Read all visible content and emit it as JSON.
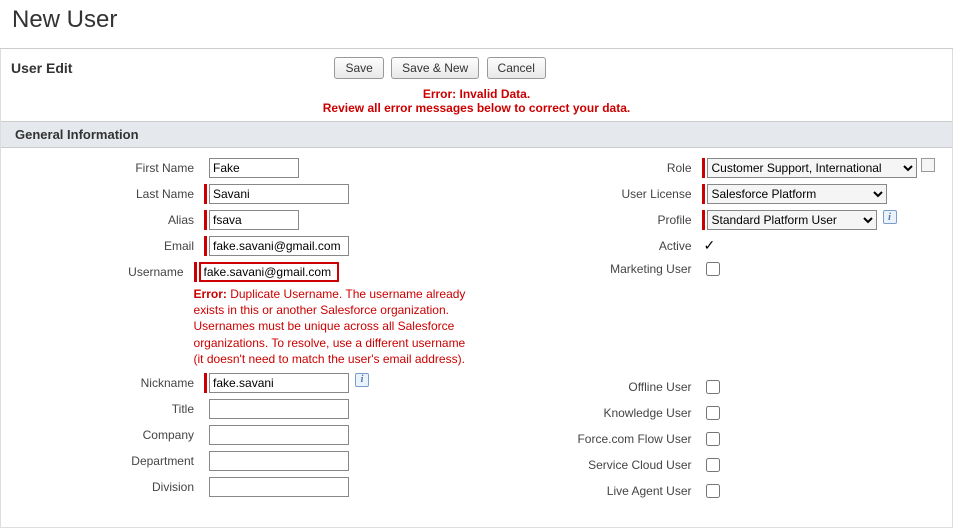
{
  "page": {
    "title": "New User",
    "panel_title": "User Edit"
  },
  "buttons": {
    "save": "Save",
    "save_new": "Save & New",
    "cancel": "Cancel"
  },
  "error_banner": {
    "line1": "Error: Invalid Data.",
    "line2": "Review all error messages below to correct your data."
  },
  "section": {
    "general": "General Information"
  },
  "left": {
    "first_name": {
      "label": "First Name",
      "value": "Fake"
    },
    "last_name": {
      "label": "Last Name",
      "value": "Savani"
    },
    "alias": {
      "label": "Alias",
      "value": "fsava"
    },
    "email": {
      "label": "Email",
      "value": "fake.savani@gmail.com"
    },
    "username": {
      "label": "Username",
      "value": "fake.savani@gmail.com",
      "error_label": "Error:",
      "error_text": " Duplicate Username.\nThe username already exists in this or another Salesforce organization. Usernames must be unique across all Salesforce organizations. To resolve, use a different username (it doesn't need to match the user's email address)."
    },
    "nickname": {
      "label": "Nickname",
      "value": "fake.savani"
    },
    "title": {
      "label": "Title",
      "value": ""
    },
    "company": {
      "label": "Company",
      "value": ""
    },
    "department": {
      "label": "Department",
      "value": ""
    },
    "division": {
      "label": "Division",
      "value": ""
    }
  },
  "right": {
    "role": {
      "label": "Role",
      "value": "Customer Support, International"
    },
    "license": {
      "label": "User License",
      "value": "Salesforce Platform"
    },
    "profile": {
      "label": "Profile",
      "value": "Standard Platform User"
    },
    "active": {
      "label": "Active",
      "checked": true
    },
    "marketing": {
      "label": "Marketing User"
    },
    "offline": {
      "label": "Offline User"
    },
    "knowledge": {
      "label": "Knowledge User"
    },
    "flow": {
      "label": "Force.com Flow User"
    },
    "service": {
      "label": "Service Cloud User"
    },
    "liveagent": {
      "label": "Live Agent User"
    }
  },
  "icons": {
    "info": "i"
  }
}
